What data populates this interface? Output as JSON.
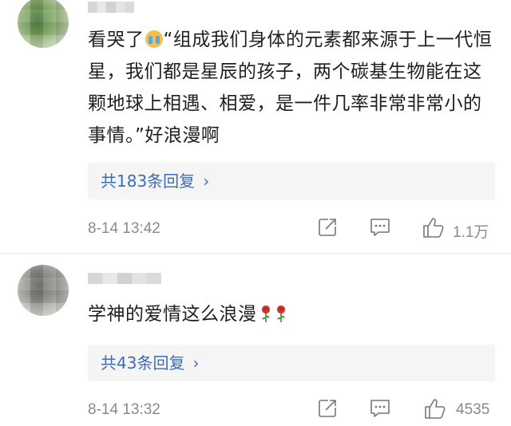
{
  "comments": [
    {
      "text_before_emoji": "看哭了",
      "emoji": "cry-emoji",
      "text_after_emoji": "“组成我们身体的元素都来源于上一代恒星，我们都是星辰的孩子，两个碳基生物能在这颗地球上相遇、相爱，是一件几率非常非常小的事情。”好浪漫啊",
      "replies_label": "共183条回复",
      "time": "8-14 13:42",
      "like_count": "1.1万"
    },
    {
      "text": "学神的爱情这么浪漫",
      "trailing_emojis": [
        "rose-icon",
        "rose-icon"
      ],
      "replies_label": "共43条回复",
      "time": "8-14 13:32",
      "like_count": "4535"
    }
  ],
  "icons": {
    "share": "share-icon",
    "comment": "comment-icon",
    "like": "thumbs-up-icon",
    "chevron": "chevron-right-icon"
  },
  "colors": {
    "link": "#3f6db3",
    "meta": "#8a8a8a",
    "reply_bg": "#f5f5f5",
    "rose": "#d0342c"
  }
}
